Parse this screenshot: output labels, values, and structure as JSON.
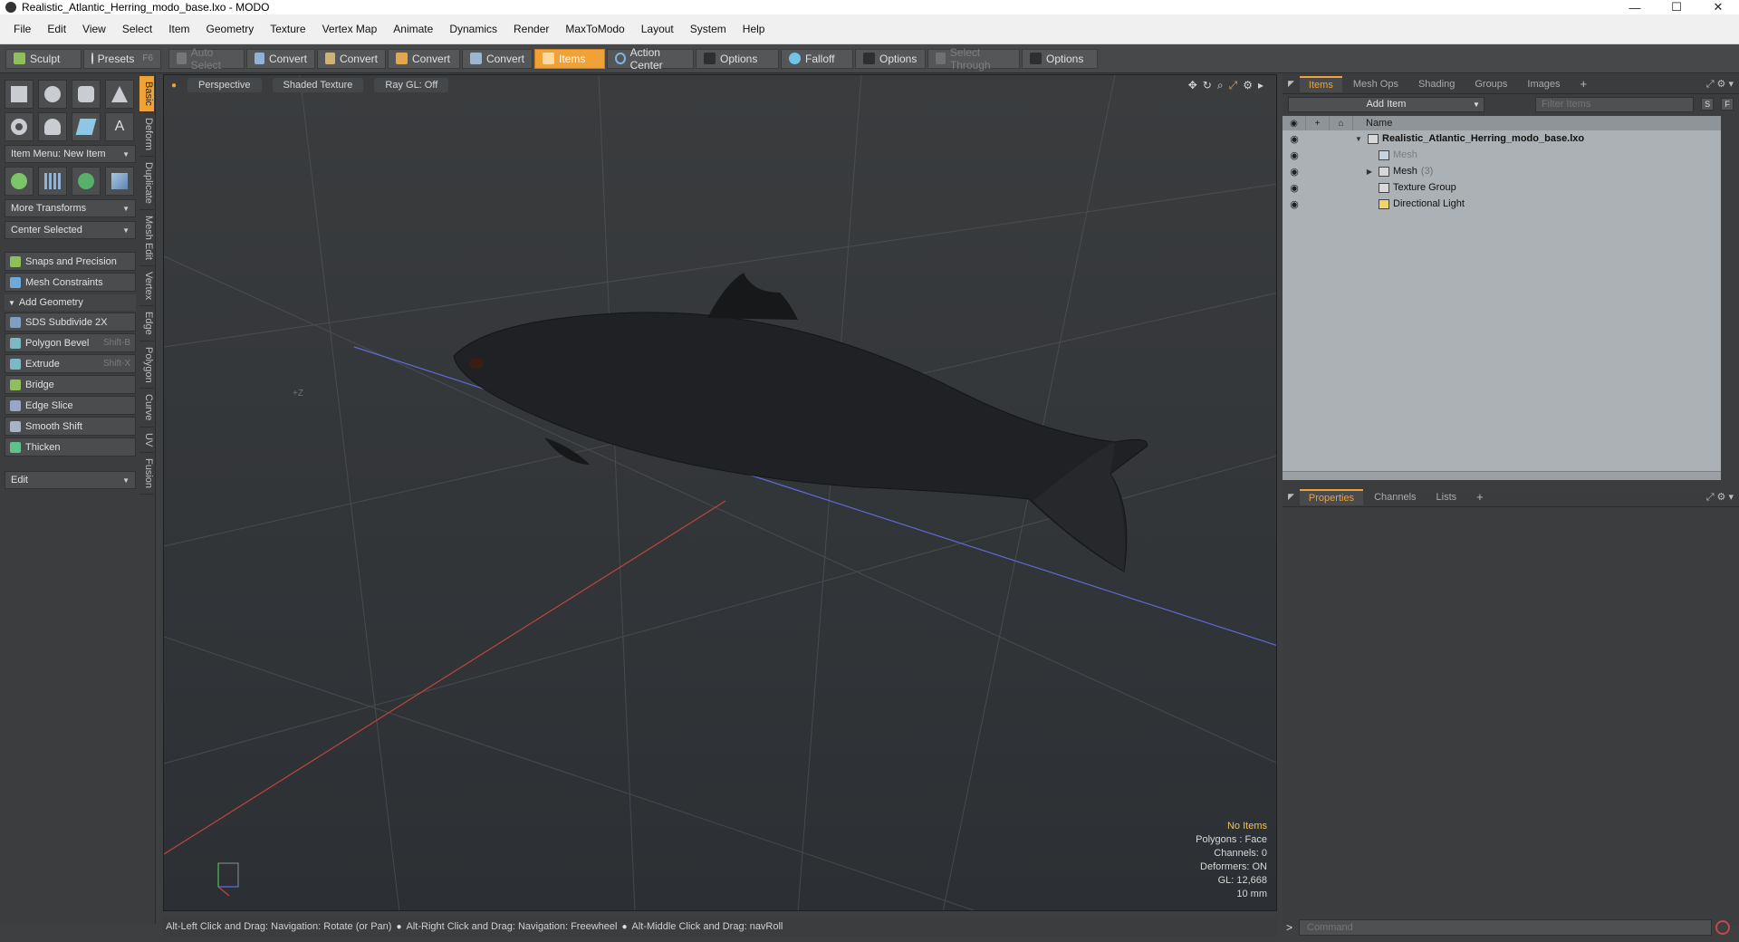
{
  "window": {
    "title": "Realistic_Atlantic_Herring_modo_base.lxo - MODO",
    "minimize": "—",
    "maximize": "☐",
    "close": "✕"
  },
  "menu": [
    "File",
    "Edit",
    "View",
    "Select",
    "Item",
    "Geometry",
    "Texture",
    "Vertex Map",
    "Animate",
    "Dynamics",
    "Render",
    "MaxToModo",
    "Layout",
    "System",
    "Help"
  ],
  "toolbar": {
    "sculpt": "Sculpt",
    "presets": "Presets",
    "presets_key": "F6",
    "auto_select": "Auto Select",
    "convert": "Convert",
    "items": "Items",
    "action_center": "Action Center",
    "options": "Options",
    "falloff": "Falloff",
    "select_through": "Select Through"
  },
  "left_panel": {
    "item_menu": "Item Menu: New Item",
    "more_transforms": "More Transforms",
    "center_selected": "Center Selected",
    "snaps": "Snaps and Precision",
    "mesh_constraints": "Mesh Constraints",
    "add_geometry": "Add Geometry",
    "tools": [
      {
        "label": "SDS Subdivide 2X",
        "key": ""
      },
      {
        "label": "Polygon Bevel",
        "key": "Shift-B"
      },
      {
        "label": "Extrude",
        "key": "Shift-X"
      },
      {
        "label": "Bridge",
        "key": ""
      },
      {
        "label": "Edge Slice",
        "key": ""
      },
      {
        "label": "Smooth Shift",
        "key": ""
      },
      {
        "label": "Thicken",
        "key": ""
      }
    ],
    "edit": "Edit",
    "vtabs": [
      "Basic",
      "Deform",
      "Duplicate",
      "Mesh Edit",
      "Vertex",
      "Edge",
      "Polygon",
      "Curve",
      "UV",
      "Fusion"
    ]
  },
  "viewport": {
    "tabs": [
      "Perspective",
      "Shaded Texture",
      "Ray GL: Off"
    ],
    "stats": {
      "selection": "No Items",
      "polygons": "Polygons : Face",
      "channels": "Channels: 0",
      "deformers": "Deformers: ON",
      "gl": "GL: 12,668",
      "scale": "10 mm"
    },
    "axis_label": "+Z"
  },
  "statusbar": {
    "hint1": "Alt-Left Click and Drag: Navigation: Rotate (or Pan)",
    "hint2": "Alt-Right Click and Drag: Navigation: Freewheel",
    "hint3": "Alt-Middle Click and Drag: navRoll"
  },
  "right_panel": {
    "top_tabs": [
      "Items",
      "Mesh Ops",
      "Shading",
      "Groups",
      "Images"
    ],
    "add_item": "Add Item",
    "filter_placeholder": "Filter Items",
    "s_btn": "S",
    "f_btn": "F",
    "name_header": "Name",
    "tree": [
      {
        "label": "Realistic_Atlantic_Herring_modo_base.lxo",
        "count": ""
      },
      {
        "label": "Mesh",
        "count": ""
      },
      {
        "label": "Mesh",
        "count": "(3)"
      },
      {
        "label": "Texture Group",
        "count": ""
      },
      {
        "label": "Directional Light",
        "count": ""
      }
    ],
    "bottom_tabs": [
      "Properties",
      "Channels",
      "Lists"
    ],
    "command_placeholder": "Command"
  }
}
